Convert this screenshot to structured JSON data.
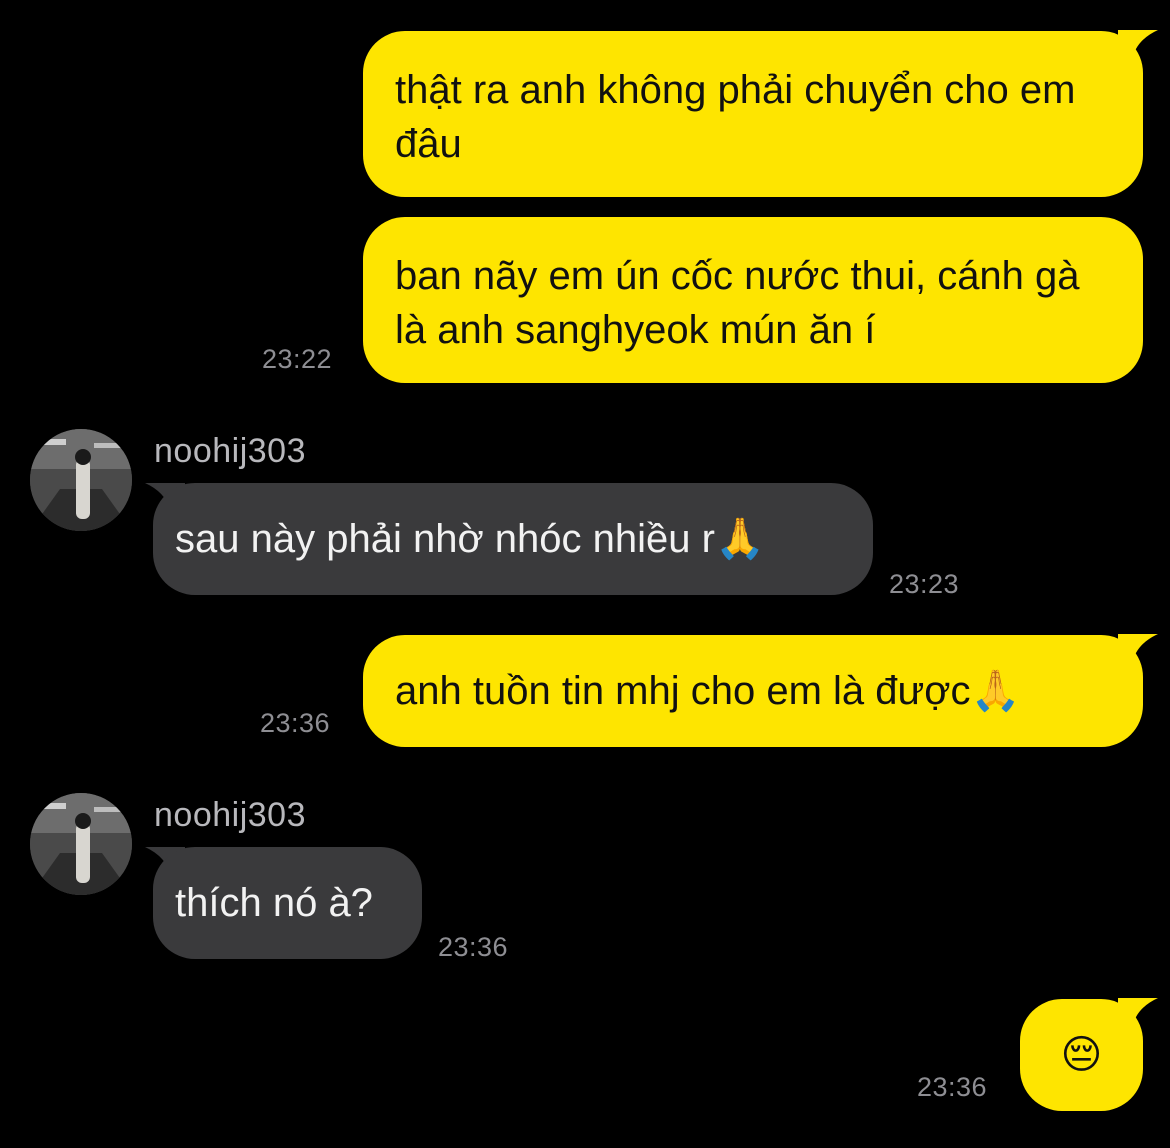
{
  "colors": {
    "outgoing_bubble": "#FEE500",
    "incoming_bubble": "#3a3a3c",
    "background": "#000000",
    "timestamp": "#8e8e93",
    "sender_name": "#b8b8bc"
  },
  "messages": [
    {
      "direction": "out",
      "text": "thật ra anh không phải chuyển cho em đâu",
      "time": ""
    },
    {
      "direction": "out",
      "text": "ban nãy em ún cốc nước thui, cánh gà là anh sanghyeok mún ăn í",
      "time": "23:22"
    },
    {
      "direction": "in",
      "sender": "noohij303",
      "avatar": "profile-photo",
      "text": "sau này phải nhờ nhóc nhiều r🙏",
      "time": "23:23"
    },
    {
      "direction": "out",
      "text": "anh tuồn tin mhj cho em là được🙏",
      "time": "23:36"
    },
    {
      "direction": "in",
      "sender": "noohij303",
      "avatar": "profile-photo",
      "text": "thích nó à?",
      "time": "23:36"
    },
    {
      "direction": "out",
      "text": "😔",
      "time": "23:36"
    }
  ]
}
